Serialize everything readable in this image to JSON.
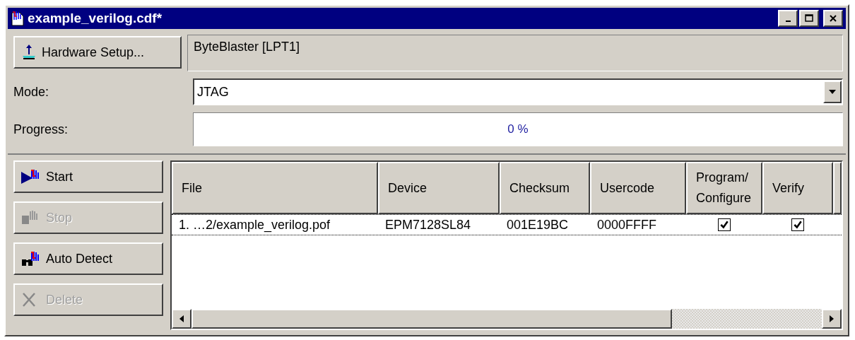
{
  "window": {
    "title": "example_verilog.cdf*"
  },
  "hardware": {
    "button": "Hardware Setup...",
    "value": "ByteBlaster [LPT1]"
  },
  "mode": {
    "label": "Mode:",
    "value": "JTAG"
  },
  "progress": {
    "label": "Progress:",
    "level": 0,
    "reading": "0 %"
  },
  "actions": [
    {
      "label": "Start",
      "kind": "start",
      "disabled": false
    },
    {
      "label": "Stop",
      "kind": "stop",
      "disabled": true
    },
    {
      "label": "Auto Detect",
      "kind": "detect",
      "disabled": false
    },
    {
      "label": "Delete",
      "kind": "delete",
      "disabled": true
    }
  ],
  "table": {
    "columns": [
      "File",
      "Device",
      "Checksum",
      "Usercode",
      "Program/ Configure",
      "Verify"
    ],
    "rows": [
      {
        "file": "1. …2/example_verilog.pof",
        "device": "EPM7128SL84",
        "checksum": "001E19BC",
        "usercode": "0000FFFF",
        "program": true,
        "verify": true
      }
    ]
  }
}
